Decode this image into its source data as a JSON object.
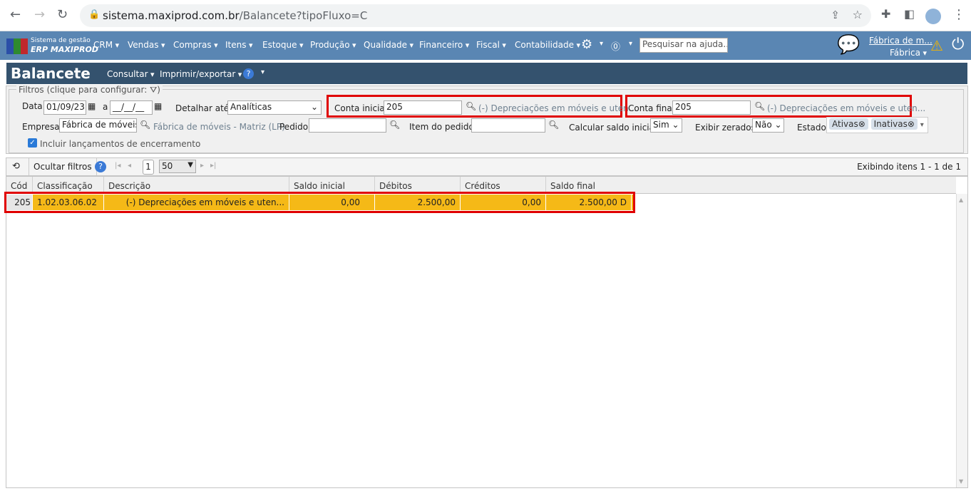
{
  "browser": {
    "url_host": "sistema.maxiprod.com.br",
    "url_path": "/Balancete?tipoFluxo=C"
  },
  "app": {
    "logo_line1": "Sistema de gestão",
    "logo_line2": "ERP MAXIPROD",
    "menu": [
      "CRM",
      "Vendas",
      "Compras",
      "Itens",
      "Estoque",
      "Produção",
      "Qualidade",
      "Financeiro",
      "Fiscal",
      "Contabilidade"
    ],
    "help_search_placeholder": "Pesquisar na ajuda...",
    "company_link": "Fábrica de m...",
    "company_short": "Fábrica"
  },
  "page": {
    "title": "Balancete",
    "actions": [
      "Consultar",
      "Imprimir/exportar"
    ]
  },
  "filters": {
    "legend": "Filtros (clique para configurar:",
    "legend_end": ")",
    "data_label": "Data",
    "data_from": "01/09/23",
    "data_sep": "a",
    "data_to": "__/__/__",
    "detalhar_label": "Detalhar até",
    "detalhar_value": "Analíticas",
    "conta_inicial_label": "Conta inicial",
    "conta_inicial_value": "205",
    "conta_inicial_desc": "(-) Depreciações em móveis e uten...",
    "conta_final_label": "Conta final",
    "conta_final_value": "205",
    "conta_final_desc": "(-) Depreciações em móveis e uten...",
    "empresa_label": "Empresa",
    "empresa_value": "Fábrica de móveis -",
    "empresa_desc": "Fábrica de móveis - Matriz (LP)",
    "pedido_label": "Pedido",
    "pedido_value": "",
    "item_pedido_label": "Item do pedido",
    "item_pedido_value": "",
    "saldo_inicial_label": "Calcular saldo inicial",
    "saldo_inicial_value": "Sim",
    "zerados_label": "Exibir zerados",
    "zerados_value": "Não",
    "estado_label": "Estado",
    "estado_chips": [
      "Ativas",
      "Inativas"
    ],
    "encerramento_label": "Incluir lançamentos de encerramento",
    "encerramento_checked": true
  },
  "toolbar": {
    "hide_filters": "Ocultar filtros",
    "page": "1",
    "page_size": "50",
    "status": "Exibindo itens 1 - 1 de 1"
  },
  "grid": {
    "columns": [
      "Cód",
      "Classificação",
      "Descrição",
      "Saldo inicial",
      "Débitos",
      "Créditos",
      "Saldo final"
    ],
    "rows": [
      {
        "cod": "205",
        "classificacao": "1.02.03.06.02",
        "descricao": "(-) Depreciações em móveis e uten...",
        "saldo_inicial": "0,00",
        "debitos": "2.500,00",
        "creditos": "0,00",
        "saldo_final": "2.500,00 D"
      }
    ]
  },
  "colors": {
    "nav": "#5a86b3",
    "title": "#34526e",
    "row_highlight": "#f5b917",
    "annotation": "#e00000"
  }
}
